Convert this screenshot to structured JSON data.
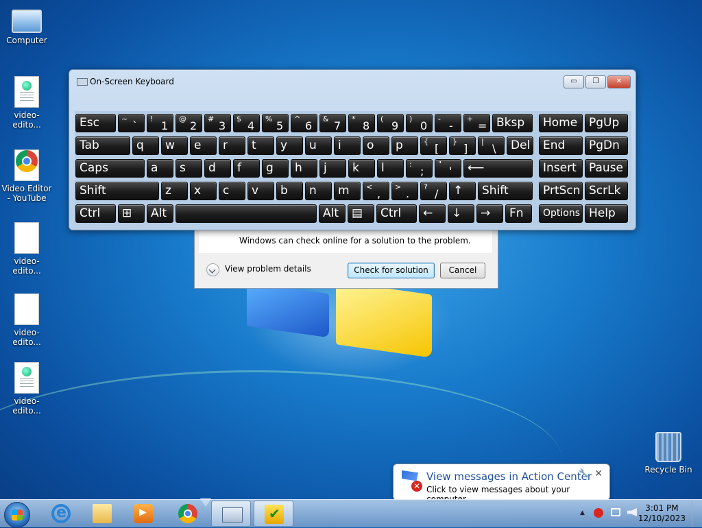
{
  "desktop": {
    "icons": [
      {
        "label": "Computer"
      },
      {
        "label": "video-edito..."
      },
      {
        "label": "Video Editor - YouTube"
      },
      {
        "label": "video-edito..."
      },
      {
        "label": "video-edito..."
      },
      {
        "label": "video-edito..."
      },
      {
        "label": "Recycle Bin"
      }
    ]
  },
  "osk": {
    "title": "On-Screen Keyboard",
    "window_buttons": {
      "minimize": "▭",
      "restore": "❐",
      "close": "✕"
    },
    "rows": [
      [
        {
          "label": "Esc"
        },
        {
          "sup": "~",
          "label": "`"
        },
        {
          "sup": "!",
          "label": "1"
        },
        {
          "sup": "@",
          "label": "2"
        },
        {
          "sup": "#",
          "label": "3"
        },
        {
          "sup": "$",
          "label": "4"
        },
        {
          "sup": "%",
          "label": "5"
        },
        {
          "sup": "^",
          "label": "6"
        },
        {
          "sup": "&",
          "label": "7"
        },
        {
          "sup": "*",
          "label": "8"
        },
        {
          "sup": "(",
          "label": "9"
        },
        {
          "sup": ")",
          "label": "0"
        },
        {
          "sup": "-",
          "label": "-"
        },
        {
          "sup": "+",
          "label": "="
        },
        {
          "label": "Bksp"
        },
        {
          "label": "Home"
        },
        {
          "label": "PgUp"
        }
      ],
      [
        {
          "label": "Tab"
        },
        {
          "label": "q"
        },
        {
          "label": "w"
        },
        {
          "label": "e"
        },
        {
          "label": "r"
        },
        {
          "label": "t"
        },
        {
          "label": "y"
        },
        {
          "label": "u"
        },
        {
          "label": "i"
        },
        {
          "label": "o"
        },
        {
          "label": "p"
        },
        {
          "sup": "{",
          "label": "["
        },
        {
          "sup": "}",
          "label": "]"
        },
        {
          "sup": "|",
          "label": "\\"
        },
        {
          "label": "Del"
        },
        {
          "label": "End"
        },
        {
          "label": "PgDn"
        }
      ],
      [
        {
          "label": "Caps"
        },
        {
          "label": "a"
        },
        {
          "label": "s"
        },
        {
          "label": "d"
        },
        {
          "label": "f"
        },
        {
          "label": "g"
        },
        {
          "label": "h"
        },
        {
          "label": "j"
        },
        {
          "label": "k"
        },
        {
          "label": "l"
        },
        {
          "sup": ":",
          "label": ";"
        },
        {
          "sup": "\"",
          "label": "'"
        },
        {
          "label": "⟵"
        },
        {
          "label": "Insert"
        },
        {
          "label": "Pause"
        }
      ],
      [
        {
          "label": "Shift"
        },
        {
          "label": "z"
        },
        {
          "label": "x"
        },
        {
          "label": "c"
        },
        {
          "label": "v"
        },
        {
          "label": "b"
        },
        {
          "label": "n"
        },
        {
          "label": "m"
        },
        {
          "sup": "<",
          "label": ","
        },
        {
          "sup": ">",
          "label": "."
        },
        {
          "sup": "?",
          "label": "/"
        },
        {
          "label": "↑"
        },
        {
          "label": "Shift"
        },
        {
          "label": "PrtScn"
        },
        {
          "label": "ScrLk"
        }
      ],
      [
        {
          "label": "Ctrl"
        },
        {
          "label": "⊞"
        },
        {
          "label": "Alt"
        },
        {
          "label": ""
        },
        {
          "label": "Alt"
        },
        {
          "label": "▤"
        },
        {
          "label": "Ctrl"
        },
        {
          "label": "←"
        },
        {
          "label": "↓"
        },
        {
          "label": "→"
        },
        {
          "label": "Fn"
        },
        {
          "label": "Options"
        },
        {
          "label": "Help"
        }
      ]
    ]
  },
  "dialog": {
    "message": "Windows can check online for a solution to the problem.",
    "details_label": "View problem details",
    "check_label": "Check for solution",
    "cancel_label": "Cancel"
  },
  "balloon": {
    "title": "View messages in Action Center",
    "text": "Click to view messages about your computer.",
    "close": "✕",
    "tools": "🔧"
  },
  "taskbar": {
    "items": [
      "internet-explorer",
      "windows-explorer",
      "media-player",
      "chrome",
      "on-screen-keyboard",
      "task-app"
    ],
    "tray_up_arrow": "▲",
    "time": "3:01 PM",
    "date": "12/10/2023"
  }
}
